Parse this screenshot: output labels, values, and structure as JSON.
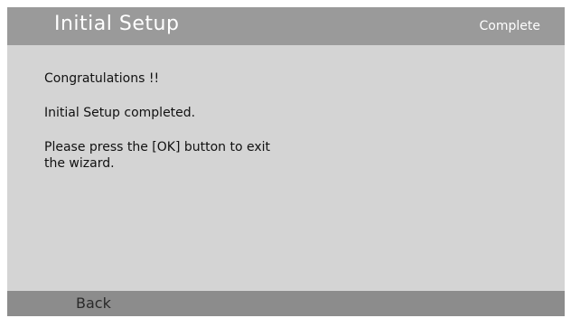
{
  "header": {
    "title": "Initial Setup",
    "status": "Complete"
  },
  "content": {
    "line1": "Congratulations !!",
    "line2": "Initial Setup completed.",
    "line3": "Please press the [OK] button to exit\nthe wizard."
  },
  "footer": {
    "back_label": "Back"
  },
  "colors": {
    "header_bg": "#9a9a9a",
    "panel_bg": "#d4d4d4",
    "footer_bg": "#8c8c8c"
  }
}
